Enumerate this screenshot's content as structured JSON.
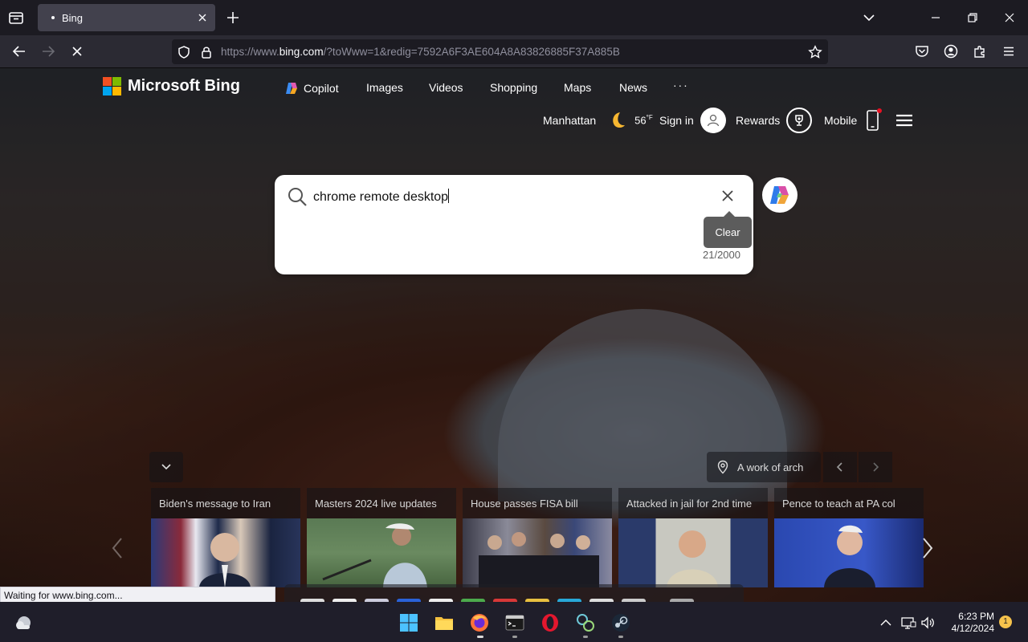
{
  "browser": {
    "tab_title": "Bing",
    "url_prefix": "https://www.",
    "url_domain": "bing.com",
    "url_rest": "/?toWww=1&redig=7592A6F3AE604A8A83826885F37A885B",
    "status_text": "Waiting for www.bing.com..."
  },
  "bing": {
    "logo_text": "Microsoft Bing",
    "nav": {
      "copilot": "Copilot",
      "images": "Images",
      "videos": "Videos",
      "shopping": "Shopping",
      "maps": "Maps",
      "news": "News",
      "more": "· · ·"
    },
    "header": {
      "location": "Manhattan",
      "temperature": "56",
      "temp_unit": "°F",
      "sign_in": "Sign in",
      "rewards": "Rewards",
      "mobile": "Mobile"
    },
    "search": {
      "query": "chrome remote desktop",
      "char_count": "21/2000",
      "clear_tooltip": "Clear"
    },
    "image_info": {
      "caption": "A work of arch"
    },
    "news": [
      {
        "title": "Biden's message to Iran"
      },
      {
        "title": "Masters 2024 live updates"
      },
      {
        "title": "House passes FISA bill"
      },
      {
        "title": "Attacked in jail for 2nd time"
      },
      {
        "title": "Pence to teach at PA col"
      }
    ]
  },
  "taskbar": {
    "time": "6:23 PM",
    "date": "4/12/2024",
    "notification_count": "1"
  },
  "colors": {
    "ms_red": "#f25022",
    "ms_green": "#7fba00",
    "ms_blue": "#00a4ef",
    "ms_yellow": "#ffb900",
    "firefox_tab_active": "#42414d",
    "urlbar_bg": "#1c1b22"
  }
}
